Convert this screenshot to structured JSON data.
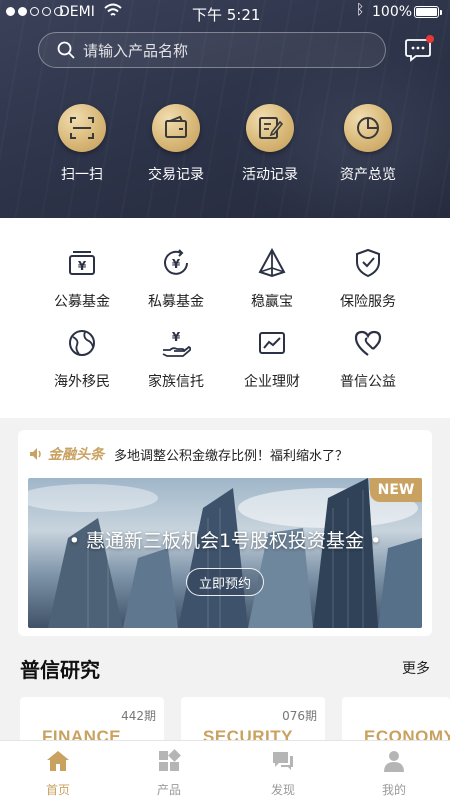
{
  "status_bar": {
    "carrier": "DEMI",
    "time": "下午 5:21",
    "battery": "100%"
  },
  "search": {
    "placeholder": "请输入产品名称"
  },
  "quick_actions": [
    {
      "label": "扫一扫",
      "icon": "scan-icon"
    },
    {
      "label": "交易记录",
      "icon": "wallet-icon"
    },
    {
      "label": "活动记录",
      "icon": "notepad-icon"
    },
    {
      "label": "资产总览",
      "icon": "pie-chart-icon"
    }
  ],
  "services": [
    {
      "label": "公募基金",
      "icon": "yen-card-icon"
    },
    {
      "label": "私募基金",
      "icon": "yen-cycle-icon"
    },
    {
      "label": "稳赢宝",
      "icon": "pyramid-icon"
    },
    {
      "label": "保险服务",
      "icon": "shield-check-icon"
    },
    {
      "label": "海外移民",
      "icon": "globe-icon"
    },
    {
      "label": "家族信托",
      "icon": "hand-yen-icon"
    },
    {
      "label": "企业理财",
      "icon": "trend-chart-icon"
    },
    {
      "label": "普信公益",
      "icon": "heart-icon"
    }
  ],
  "news": {
    "badge": "金融头条",
    "headline": "多地调整公积金缴存比例！福利缩水了？"
  },
  "banner": {
    "tag": "NEW",
    "title": "• 惠通新三板机会1号股权投资基金 •",
    "button": "立即预约"
  },
  "research": {
    "title": "普信研究",
    "more": "更多",
    "cards": [
      {
        "word": "FINANCE",
        "issue": "442期"
      },
      {
        "word": "SECURITY",
        "issue": "076期"
      },
      {
        "word": "ECONOMY",
        "issue": ""
      }
    ]
  },
  "tabs": [
    {
      "label": "首页",
      "icon": "home-icon",
      "active": true
    },
    {
      "label": "产品",
      "icon": "grid-icon",
      "active": false
    },
    {
      "label": "发现",
      "icon": "chat-icon",
      "active": false
    },
    {
      "label": "我的",
      "icon": "person-icon",
      "active": false
    }
  ],
  "colors": {
    "gold": "#c9a261",
    "header_bg": "#2c3247",
    "icon_dark": "#2b3245"
  }
}
